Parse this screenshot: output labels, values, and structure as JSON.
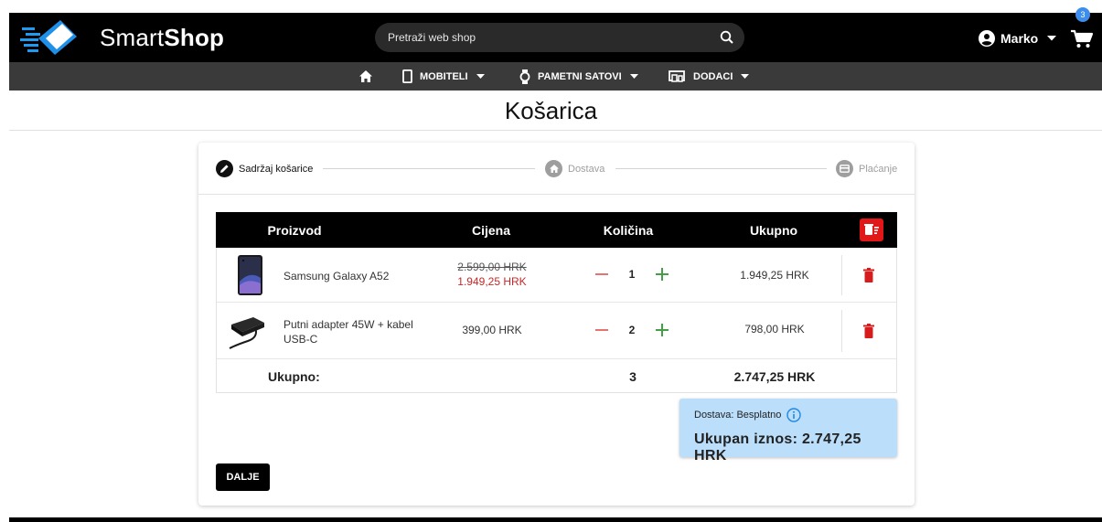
{
  "header": {
    "brand_regular": "Smart",
    "brand_bold": "Shop",
    "search_placeholder": "Pretraži web shop",
    "user_name": "Marko",
    "cart_count": "3"
  },
  "nav": {
    "items": [
      {
        "label": "MOBITELI",
        "icon": "phone-icon"
      },
      {
        "label": "PAMETNI SATOVI",
        "icon": "watch-icon"
      },
      {
        "label": "DODACI",
        "icon": "devices-icon"
      }
    ]
  },
  "page_title": "Košarica",
  "stepper": {
    "steps": [
      {
        "label": "Sadržaj košarice",
        "icon": "edit-icon",
        "state": "active"
      },
      {
        "label": "Dostava",
        "icon": "home-icon",
        "state": "inactive"
      },
      {
        "label": "Plaćanje",
        "icon": "card-icon",
        "state": "inactive"
      }
    ]
  },
  "table": {
    "headers": {
      "product": "Proizvod",
      "price": "Cijena",
      "quantity": "Količina",
      "total": "Ukupno"
    },
    "rows": [
      {
        "name": "Samsung Galaxy A52",
        "old_price": "2.599,00 HRK",
        "price": "1.949,25 HRK",
        "quantity": "1",
        "total": "1.949,25 HRK"
      },
      {
        "name": "Putni adapter 45W + kabel USB-C",
        "price": "399,00 HRK",
        "quantity": "2",
        "total": "798,00 HRK"
      }
    ],
    "summary": {
      "label": "Ukupno:",
      "quantity": "3",
      "total": "2.747,25 HRK"
    }
  },
  "summary_box": {
    "shipping": "Dostava: Besplatno",
    "grand_total": "Ukupan iznos: 2.747,25 HRK"
  },
  "next_button": "DALJE",
  "colors": {
    "accent_red": "#e21717",
    "summary_bg": "#bbdefb",
    "badge": "#3d8eea"
  }
}
